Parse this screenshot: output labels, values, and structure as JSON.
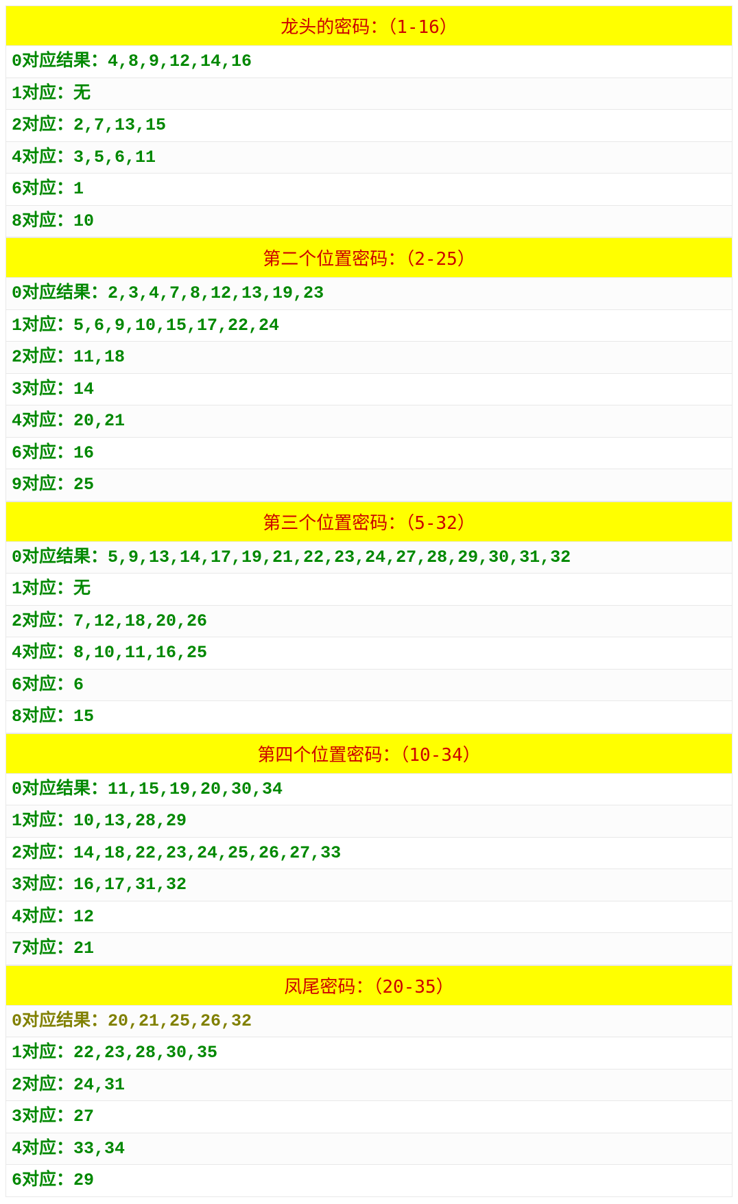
{
  "sections": [
    {
      "title": "龙头的密码：（1-16）",
      "rows": [
        {
          "label": "0对应结果：",
          "value": "4,8,9,12,14,16",
          "muted": false
        },
        {
          "label": "1对应：",
          "value": "无",
          "muted": false
        },
        {
          "label": "2对应：",
          "value": "2,7,13,15",
          "muted": false
        },
        {
          "label": "4对应：",
          "value": "3,5,6,11",
          "muted": false
        },
        {
          "label": "6对应：",
          "value": "1",
          "muted": false
        },
        {
          "label": "8对应：",
          "value": "10",
          "muted": false
        }
      ]
    },
    {
      "title": "第二个位置密码：（2-25）",
      "rows": [
        {
          "label": "0对应结果：",
          "value": "2,3,4,7,8,12,13,19,23",
          "muted": false
        },
        {
          "label": "1对应：",
          "value": "5,6,9,10,15,17,22,24",
          "muted": false
        },
        {
          "label": "2对应：",
          "value": "11,18",
          "muted": false
        },
        {
          "label": "3对应：",
          "value": "14",
          "muted": false
        },
        {
          "label": "4对应：",
          "value": "20,21",
          "muted": false
        },
        {
          "label": "6对应：",
          "value": "16",
          "muted": false
        },
        {
          "label": "9对应：",
          "value": "25",
          "muted": false
        }
      ]
    },
    {
      "title": "第三个位置密码：（5-32）",
      "rows": [
        {
          "label": "0对应结果：",
          "value": "5,9,13,14,17,19,21,22,23,24,27,28,29,30,31,32",
          "muted": false
        },
        {
          "label": "1对应：",
          "value": "无",
          "muted": false
        },
        {
          "label": "2对应：",
          "value": "7,12,18,20,26",
          "muted": false
        },
        {
          "label": "4对应：",
          "value": "8,10,11,16,25",
          "muted": false
        },
        {
          "label": "6对应：",
          "value": "6",
          "muted": false
        },
        {
          "label": "8对应：",
          "value": "15",
          "muted": false
        }
      ]
    },
    {
      "title": "第四个位置密码：（10-34）",
      "rows": [
        {
          "label": "0对应结果：",
          "value": "11,15,19,20,30,34",
          "muted": false
        },
        {
          "label": "1对应：",
          "value": "10,13,28,29",
          "muted": false
        },
        {
          "label": "2对应：",
          "value": "14,18,22,23,24,25,26,27,33",
          "muted": false
        },
        {
          "label": "3对应：",
          "value": "16,17,31,32",
          "muted": false
        },
        {
          "label": "4对应：",
          "value": "12",
          "muted": false
        },
        {
          "label": "7对应：",
          "value": "21",
          "muted": false
        }
      ]
    },
    {
      "title": "凤尾密码：（20-35）",
      "rows": [
        {
          "label": "0对应结果：",
          "value": "20,21,25,26,32",
          "muted": true
        },
        {
          "label": "1对应：",
          "value": "22,23,28,30,35",
          "muted": false
        },
        {
          "label": "2对应：",
          "value": "24,31",
          "muted": false
        },
        {
          "label": "3对应：",
          "value": "27",
          "muted": false
        },
        {
          "label": "4对应：",
          "value": "33,34",
          "muted": false
        },
        {
          "label": "6对应：",
          "value": "29",
          "muted": false
        }
      ]
    }
  ]
}
